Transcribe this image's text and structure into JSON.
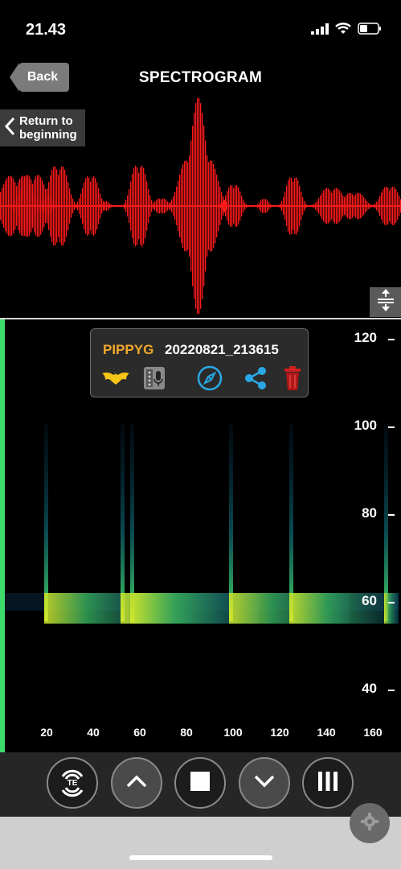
{
  "status_bar": {
    "time": "21.43"
  },
  "nav": {
    "back_label": "Back",
    "title": "SPECTROGRAM"
  },
  "return_button": {
    "line1": "Return to",
    "line2": "beginning"
  },
  "recording": {
    "species": "PIPPYG",
    "filename": "20220821_213615"
  },
  "y_axis": {
    "labels": [
      "120",
      "100",
      "80",
      "60",
      "40"
    ]
  },
  "x_axis": {
    "labels": [
      "20",
      "40",
      "60",
      "80",
      "100",
      "120",
      "140",
      "160"
    ]
  },
  "controls": [
    {
      "name": "trigger-button",
      "icon": "te-signal-icon"
    },
    {
      "name": "up-button",
      "icon": "chevron-up-icon"
    },
    {
      "name": "stop-button",
      "icon": "stop-icon"
    },
    {
      "name": "down-button",
      "icon": "chevron-down-icon"
    },
    {
      "name": "pause-button",
      "icon": "bars-icon"
    }
  ],
  "colors": {
    "waveform": "#ff1a1a",
    "species": "#f1a92a",
    "accent_bar": "#3ddc6a",
    "icon_blue": "#2aa8e6",
    "delete_red": "#d01f1f"
  },
  "te_label": "TE"
}
